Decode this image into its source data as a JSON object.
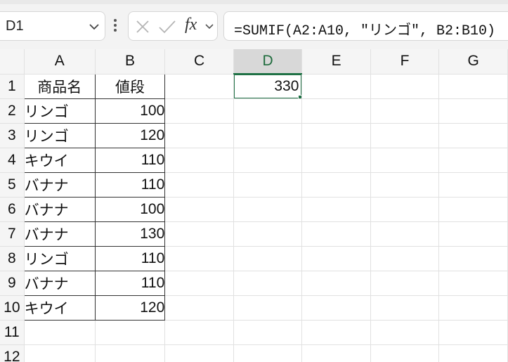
{
  "name_box": {
    "value": "D1"
  },
  "formula_bar": {
    "formula": "=SUMIF(A2:A10, \"リンゴ\", B2:B10)",
    "fx_label": "fx"
  },
  "columns": [
    "A",
    "B",
    "C",
    "D",
    "E",
    "F",
    "G"
  ],
  "active_column": "D",
  "rows": [
    {
      "n": "1",
      "a": "商品名",
      "b": "値段",
      "d": "330"
    },
    {
      "n": "2",
      "a": "リンゴ",
      "b": "100"
    },
    {
      "n": "3",
      "a": "リンゴ",
      "b": "120"
    },
    {
      "n": "4",
      "a": "キウイ",
      "b": "110"
    },
    {
      "n": "5",
      "a": "バナナ",
      "b": "110"
    },
    {
      "n": "6",
      "a": "バナナ",
      "b": "100"
    },
    {
      "n": "7",
      "a": "バナナ",
      "b": "130"
    },
    {
      "n": "8",
      "a": "リンゴ",
      "b": "110"
    },
    {
      "n": "9",
      "a": "バナナ",
      "b": "110"
    },
    {
      "n": "10",
      "a": "キウイ",
      "b": "120"
    },
    {
      "n": "11"
    },
    {
      "n": "12"
    }
  ],
  "selected_cell": "D1",
  "colors": {
    "accent": "#1f7145",
    "header_bg": "#f5f5f5",
    "active_header_bg": "#d8d8d8"
  }
}
